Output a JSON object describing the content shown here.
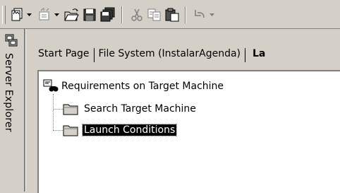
{
  "side_panel": {
    "label": "Server Explorer",
    "icon": "server-explorer-icon"
  },
  "toolbar": {
    "buttons": [
      {
        "name": "new-project-icon",
        "has_dropdown": true
      },
      {
        "name": "add-item-icon",
        "has_dropdown": true
      },
      {
        "name": "open-folder-icon",
        "has_dropdown": false
      },
      {
        "name": "save-icon",
        "has_dropdown": false
      },
      {
        "name": "save-all-icon",
        "has_dropdown": false
      },
      {
        "name": "cut-icon",
        "has_dropdown": false
      },
      {
        "name": "copy-icon",
        "has_dropdown": false
      },
      {
        "name": "paste-icon",
        "has_dropdown": false
      },
      {
        "name": "undo-icon",
        "has_dropdown": true
      }
    ]
  },
  "doc_tabs": {
    "tabs": [
      {
        "label": "Start Page",
        "active": false
      },
      {
        "label": "File System (InstalarAgenda)",
        "active": false
      },
      {
        "label": "La",
        "active": true
      }
    ]
  },
  "tree": {
    "root_label": "Requirements on Target Machine",
    "children": [
      {
        "label": "Search Target Machine",
        "selected": false
      },
      {
        "label": "Launch Conditions",
        "selected": true
      }
    ]
  },
  "colors": {
    "chrome": "#d4d0c8",
    "pane": "#ffffff",
    "selection": "#000000",
    "shadow": "#808080"
  }
}
